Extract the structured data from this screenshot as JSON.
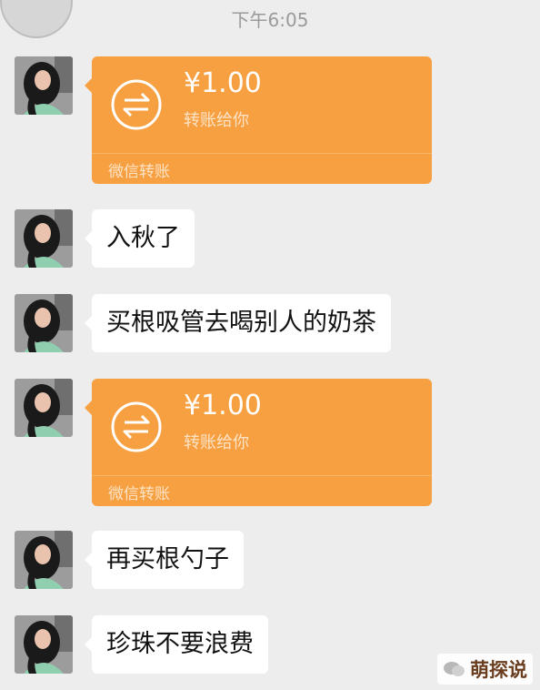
{
  "chat": {
    "timestamp": "下午6:05",
    "messages": [
      {
        "type": "transfer",
        "amount": "¥1.00",
        "note": "转账给你",
        "footer": "微信转账"
      },
      {
        "type": "text",
        "text": "入秋了"
      },
      {
        "type": "text",
        "text": "买根吸管去喝别人的奶茶"
      },
      {
        "type": "transfer",
        "amount": "¥1.00",
        "note": "转账给你",
        "footer": "微信转账"
      },
      {
        "type": "text",
        "text": "再买根勺子"
      },
      {
        "type": "text",
        "text": "珍珠不要浪费"
      }
    ]
  },
  "watermark": {
    "text": "萌探说",
    "icon": "wechat-official-account-icon"
  },
  "colors": {
    "transfer": "#f7a042",
    "background": "#ededed",
    "bubble": "#ffffff"
  }
}
